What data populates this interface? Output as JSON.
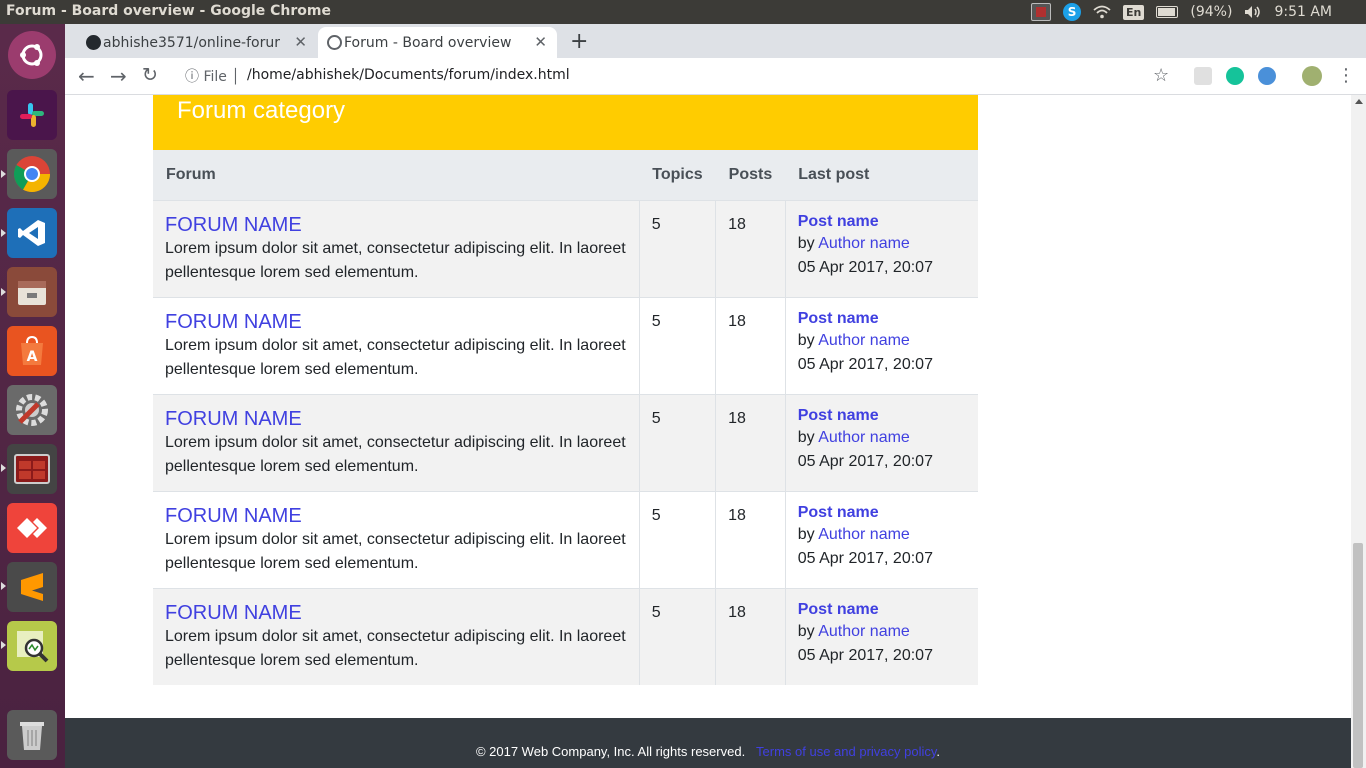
{
  "os": {
    "window_title": "Forum - Board overview - Google Chrome",
    "battery": "(94%)",
    "clock": "9:51 AM",
    "keyboard": "En",
    "launcher": [
      "ubuntu-dash",
      "slack",
      "chrome",
      "vscode",
      "files",
      "software-center",
      "system-settings",
      "terminal",
      "anydesk",
      "sublime-text",
      "system-monitor",
      "trash"
    ]
  },
  "browser": {
    "tabs": [
      {
        "label": "abhishe3571/online-forur"
      },
      {
        "label": "Forum - Board overview"
      }
    ],
    "new_tab": "+",
    "url_prefix": "File",
    "url": "/home/abhishek/Documents/forum/index.html"
  },
  "page": {
    "category_title": "Forum category",
    "columns": {
      "forum": "Forum",
      "topics": "Topics",
      "posts": "Posts",
      "last_post": "Last post"
    },
    "rows": [
      {
        "name": "FORUM NAME",
        "desc": "Lorem ipsum dolor sit amet, consectetur adipiscing elit. In laoreet pellentesque lorem sed elementum.",
        "topics": "5",
        "posts": "18",
        "post_name": "Post name",
        "by": "by",
        "author": "Author name",
        "date": "05 Apr 2017, 20:07"
      },
      {
        "name": "FORUM NAME",
        "desc": "Lorem ipsum dolor sit amet, consectetur adipiscing elit. In laoreet pellentesque lorem sed elementum.",
        "topics": "5",
        "posts": "18",
        "post_name": "Post name",
        "by": "by",
        "author": "Author name",
        "date": "05 Apr 2017, 20:07"
      },
      {
        "name": "FORUM NAME",
        "desc": "Lorem ipsum dolor sit amet, consectetur adipiscing elit. In laoreet pellentesque lorem sed elementum.",
        "topics": "5",
        "posts": "18",
        "post_name": "Post name",
        "by": "by",
        "author": "Author name",
        "date": "05 Apr 2017, 20:07"
      },
      {
        "name": "FORUM NAME",
        "desc": "Lorem ipsum dolor sit amet, consectetur adipiscing elit. In laoreet pellentesque lorem sed elementum.",
        "topics": "5",
        "posts": "18",
        "post_name": "Post name",
        "by": "by",
        "author": "Author name",
        "date": "05 Apr 2017, 20:07"
      },
      {
        "name": "FORUM NAME",
        "desc": "Lorem ipsum dolor sit amet, consectetur adipiscing elit. In laoreet pellentesque lorem sed elementum.",
        "topics": "5",
        "posts": "18",
        "post_name": "Post name",
        "by": "by",
        "author": "Author name",
        "date": "05 Apr 2017, 20:07"
      }
    ],
    "footer_text": "© 2017 Web Company, Inc.  All rights reserved.",
    "footer_link": "Terms of use and privacy policy",
    "footer_end": "."
  },
  "colors": {
    "category_header": "#ffcc00",
    "link": "#4040e0",
    "footer_bg": "#343a40",
    "launcher_bg": "#5a2a4a"
  }
}
